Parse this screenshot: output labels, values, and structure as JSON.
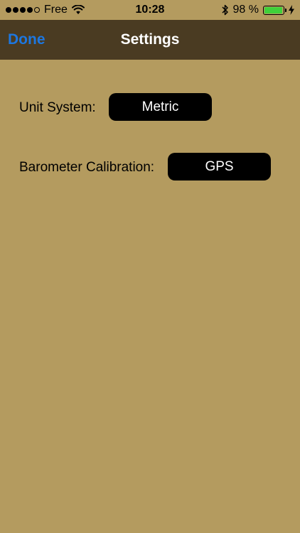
{
  "status_bar": {
    "carrier": "Free",
    "time": "10:28",
    "battery_text": "98 %",
    "battery_level": 0.98,
    "battery_color": "#3fd13a",
    "signal_bars": 4,
    "signal_total": 5,
    "icons": [
      "wifi-icon",
      "bluetooth-icon",
      "charging-bolt-icon"
    ]
  },
  "nav": {
    "done_label": "Done",
    "title": "Settings",
    "background": "#4a3b22",
    "accent": "#1d77e0"
  },
  "settings": {
    "unit_system": {
      "label": "Unit System:",
      "value": "Metric"
    },
    "barometer_calibration": {
      "label": "Barometer Calibration:",
      "value": "GPS"
    }
  },
  "colors": {
    "background": "#b49b5f",
    "button_background": "#000000",
    "button_text": "#ffffff"
  }
}
